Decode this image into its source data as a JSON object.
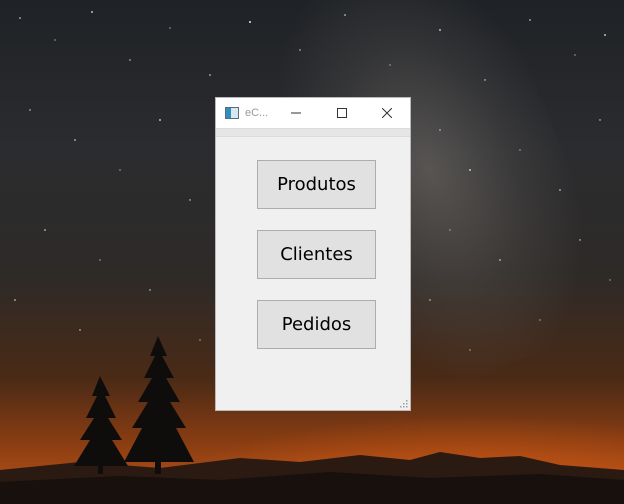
{
  "window": {
    "title": "eC...",
    "minimize_label": "—",
    "maximize_label": "☐",
    "close_label": "✕"
  },
  "menu": {
    "buttons": [
      {
        "label": "Produtos"
      },
      {
        "label": "Clientes"
      },
      {
        "label": "Pedidos"
      }
    ]
  },
  "icons": {
    "app": "app-icon",
    "minimize": "minimize-icon",
    "maximize": "maximize-icon",
    "close": "close-icon",
    "resize": "resize-grip-icon"
  },
  "colors": {
    "window_bg": "#f0f0f0",
    "titlebar_bg": "#ffffff",
    "button_face": "#e1e1e1",
    "button_border": "#adadad",
    "sky_top": "#1f2226",
    "horizon_glow": "#c0561a"
  }
}
